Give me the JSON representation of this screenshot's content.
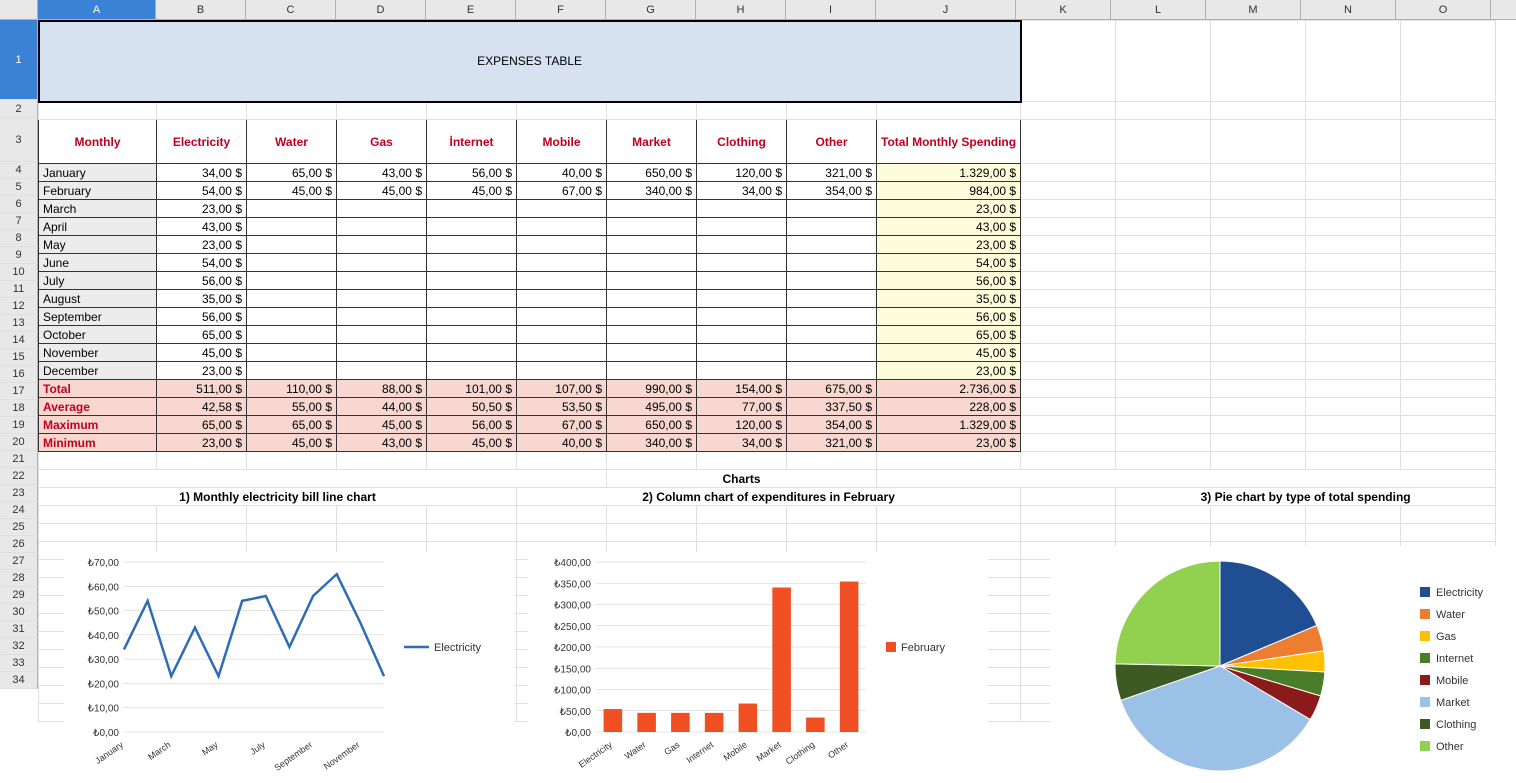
{
  "columns": [
    "A",
    "B",
    "C",
    "D",
    "E",
    "F",
    "G",
    "H",
    "I",
    "J",
    "K",
    "L",
    "M",
    "N",
    "O"
  ],
  "col_widths": {
    "A": 118,
    "B": 90,
    "C": 90,
    "D": 90,
    "E": 90,
    "F": 90,
    "G": 90,
    "H": 90,
    "I": 90,
    "J": 140,
    "K": 95,
    "L": 95,
    "M": 95,
    "N": 95,
    "O": 95
  },
  "title": "EXPENSES TABLE",
  "headers": [
    "Monthly",
    "Electricity",
    "Water",
    "Gas",
    "İnternet",
    "Mobile",
    "Market",
    "Clothing",
    "Other",
    "Total Monthly Spending"
  ],
  "rows": [
    {
      "m": "January",
      "v": [
        "34,00 $",
        "65,00 $",
        "43,00 $",
        "56,00 $",
        "40,00 $",
        "650,00 $",
        "120,00 $",
        "321,00 $"
      ],
      "t": "1.329,00 $"
    },
    {
      "m": "February",
      "v": [
        "54,00 $",
        "45,00 $",
        "45,00 $",
        "45,00 $",
        "67,00 $",
        "340,00 $",
        "34,00 $",
        "354,00 $"
      ],
      "t": "984,00 $"
    },
    {
      "m": "March",
      "v": [
        "23,00 $",
        "",
        "",
        "",
        "",
        "",
        "",
        ""
      ],
      "t": "23,00 $"
    },
    {
      "m": "April",
      "v": [
        "43,00 $",
        "",
        "",
        "",
        "",
        "",
        "",
        ""
      ],
      "t": "43,00 $"
    },
    {
      "m": "May",
      "v": [
        "23,00 $",
        "",
        "",
        "",
        "",
        "",
        "",
        ""
      ],
      "t": "23,00 $"
    },
    {
      "m": "June",
      "v": [
        "54,00 $",
        "",
        "",
        "",
        "",
        "",
        "",
        ""
      ],
      "t": "54,00 $"
    },
    {
      "m": "July",
      "v": [
        "56,00 $",
        "",
        "",
        "",
        "",
        "",
        "",
        ""
      ],
      "t": "56,00 $"
    },
    {
      "m": "August",
      "v": [
        "35,00 $",
        "",
        "",
        "",
        "",
        "",
        "",
        ""
      ],
      "t": "35,00 $"
    },
    {
      "m": "September",
      "v": [
        "56,00 $",
        "",
        "",
        "",
        "",
        "",
        "",
        ""
      ],
      "t": "56,00 $"
    },
    {
      "m": "October",
      "v": [
        "65,00 $",
        "",
        "",
        "",
        "",
        "",
        "",
        ""
      ],
      "t": "65,00 $"
    },
    {
      "m": "November",
      "v": [
        "45,00 $",
        "",
        "",
        "",
        "",
        "",
        "",
        ""
      ],
      "t": "45,00 $"
    },
    {
      "m": "December",
      "v": [
        "23,00 $",
        "",
        "",
        "",
        "",
        "",
        "",
        ""
      ],
      "t": "23,00 $"
    }
  ],
  "stats": [
    {
      "label": "Total",
      "v": [
        "511,00 $",
        "110,00 $",
        "88,00 $",
        "101,00 $",
        "107,00 $",
        "990,00 $",
        "154,00 $",
        "675,00 $"
      ],
      "t": "2.736,00 $"
    },
    {
      "label": "Average",
      "v": [
        "42,58 $",
        "55,00 $",
        "44,00 $",
        "50,50 $",
        "53,50 $",
        "495,00 $",
        "77,00 $",
        "337,50 $"
      ],
      "t": "228,00 $"
    },
    {
      "label": "Maximum",
      "v": [
        "65,00 $",
        "65,00 $",
        "45,00 $",
        "56,00 $",
        "67,00 $",
        "650,00 $",
        "120,00 $",
        "354,00 $"
      ],
      "t": "1.329,00 $"
    },
    {
      "label": "Minimum",
      "v": [
        "23,00 $",
        "45,00 $",
        "43,00 $",
        "45,00 $",
        "40,00 $",
        "340,00 $",
        "34,00 $",
        "321,00 $"
      ],
      "t": "23,00 $"
    }
  ],
  "charts_heading": "Charts",
  "chart1_title": "1) Monthly electricity bill line chart",
  "chart2_title": "2) Column chart of expenditures in February",
  "chart3_title": "3) Pie chart by type of total spending",
  "chart1_legend": "Electricity",
  "chart2_legend": "February",
  "pie_legend": [
    "Electricity",
    "Water",
    "Gas",
    "Internet",
    "Mobile",
    "Market",
    "Clothing",
    "Other"
  ],
  "pie_colors": [
    "#1f4e92",
    "#ed7d31",
    "#ffc000",
    "#4a7d2a",
    "#8b1a1a",
    "#9bc2e6",
    "#3e5a23",
    "#92d050"
  ],
  "chart_data": [
    {
      "type": "line",
      "title": "Monthly electricity bill line chart",
      "categories": [
        "January",
        "February",
        "March",
        "April",
        "May",
        "June",
        "July",
        "August",
        "September",
        "October",
        "November",
        "December"
      ],
      "x_tick_labels": [
        "January",
        "March",
        "May",
        "July",
        "September",
        "November"
      ],
      "series": [
        {
          "name": "Electricity",
          "values": [
            34,
            54,
            23,
            43,
            23,
            54,
            56,
            35,
            56,
            65,
            45,
            23
          ]
        }
      ],
      "ylim": [
        0,
        70
      ],
      "y_tick_labels": [
        "₺0,00",
        "₺10,00",
        "₺20,00",
        "₺30,00",
        "₺40,00",
        "₺50,00",
        "₺60,00",
        "₺70,00"
      ],
      "line_color": "#2e6db5"
    },
    {
      "type": "bar",
      "title": "Column chart of expenditures in February",
      "categories": [
        "Electricity",
        "Water",
        "Gas",
        "Internet",
        "Mobile",
        "Market",
        "Clothing",
        "Other"
      ],
      "series": [
        {
          "name": "February",
          "values": [
            54,
            45,
            45,
            45,
            67,
            340,
            34,
            354
          ]
        }
      ],
      "ylim": [
        0,
        400
      ],
      "y_tick_labels": [
        "₺0,00",
        "₺50,00",
        "₺100,00",
        "₺150,00",
        "₺200,00",
        "₺250,00",
        "₺300,00",
        "₺350,00",
        "₺400,00"
      ],
      "bar_color": "#f04e23"
    },
    {
      "type": "pie",
      "title": "Pie chart by type of total spending",
      "categories": [
        "Electricity",
        "Water",
        "Gas",
        "Internet",
        "Mobile",
        "Market",
        "Clothing",
        "Other"
      ],
      "values": [
        511,
        110,
        88,
        101,
        107,
        990,
        154,
        675
      ],
      "colors": [
        "#1f4e92",
        "#ed7d31",
        "#ffc000",
        "#4a7d2a",
        "#8b1a1a",
        "#9bc2e6",
        "#3e5a23",
        "#92d050"
      ]
    }
  ]
}
